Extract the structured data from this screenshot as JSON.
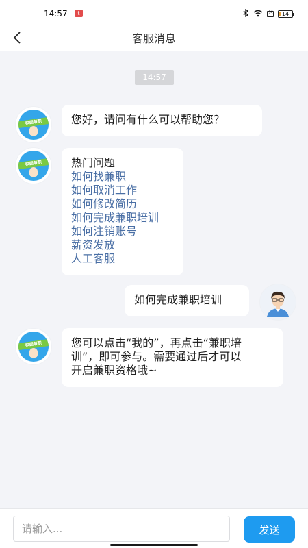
{
  "status_bar": {
    "time": "14:57",
    "app_badge": "t",
    "battery": "14"
  },
  "nav": {
    "title": "客服消息"
  },
  "chat": {
    "timestamp": "14:57",
    "greeting": "您好，请问有什么可以帮助您？",
    "hot": {
      "heading": "热门问题",
      "items": [
        "如何找兼职",
        "如何取消工作",
        "如何修改简历",
        "如何完成兼职培训",
        "如何注销账号",
        "薪资发放",
        "人工客服"
      ]
    },
    "user_message": "如何完成兼职培训",
    "reply_lines": [
      "您可以点击“我的”，再点击“兼职培",
      "训”，即可参与。需要通过后才可以",
      "开启兼职资格哦~"
    ],
    "bot_badge_text": "校园兼职"
  },
  "input": {
    "placeholder": "请输入...",
    "send_label": "发送"
  },
  "colors": {
    "accent": "#1e9bf0",
    "link": "#4a6fa5",
    "background": "#f3f4f8"
  }
}
